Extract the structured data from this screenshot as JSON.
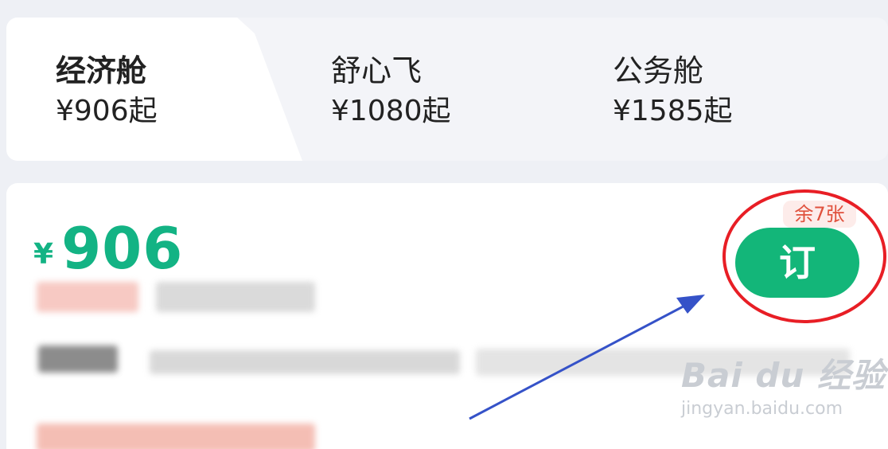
{
  "cabin_tabs": [
    {
      "title": "经济舱",
      "price": "¥906起"
    },
    {
      "title": "舒心飞",
      "price": "¥1080起"
    },
    {
      "title": "公务舱",
      "price": "¥1585起"
    }
  ],
  "fare": {
    "currency": "¥",
    "amount": "906",
    "book_label": "订",
    "seats_left": "余7张"
  },
  "watermark": {
    "logo": "Bai du 经验",
    "url": "jingyan.baidu.com"
  },
  "colors": {
    "price_green": "#13b384",
    "button_green": "#13b679",
    "badge_red": "#e0513d",
    "annotation_red": "#e81e25",
    "annotation_arrow": "#3552c8"
  }
}
